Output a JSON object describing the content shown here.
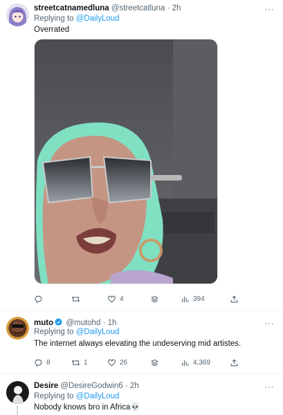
{
  "tweets": [
    {
      "name": "streetcatnamedluna",
      "handle": "@streetcatluna",
      "time": "2h",
      "replying_label": "Replying to",
      "replying_to": "@DailyLoud",
      "text": "Overrated",
      "actions": {
        "reply": "",
        "retweet": "",
        "like": "4",
        "views": "394"
      }
    },
    {
      "name": "muto",
      "handle": "@mutohd",
      "time": "1h",
      "replying_label": "Replying to",
      "replying_to": "@DailyLoud",
      "text": "The internet always elevating the undeserving mid artistes.",
      "actions": {
        "reply": "8",
        "retweet": "1",
        "like": "26",
        "views": "4,369"
      }
    },
    {
      "name": "Desire",
      "handle": "@DesireGodwin6",
      "time": "2h",
      "replying_label": "Replying to",
      "replying_to": "@DailyLoud",
      "text": "Nobody knows bro in Africa💀"
    }
  ],
  "separator": "·",
  "more_glyph": "···",
  "colors": {
    "accent": "#1d9bf0",
    "muted": "#536471",
    "divider": "#eff3f4"
  }
}
